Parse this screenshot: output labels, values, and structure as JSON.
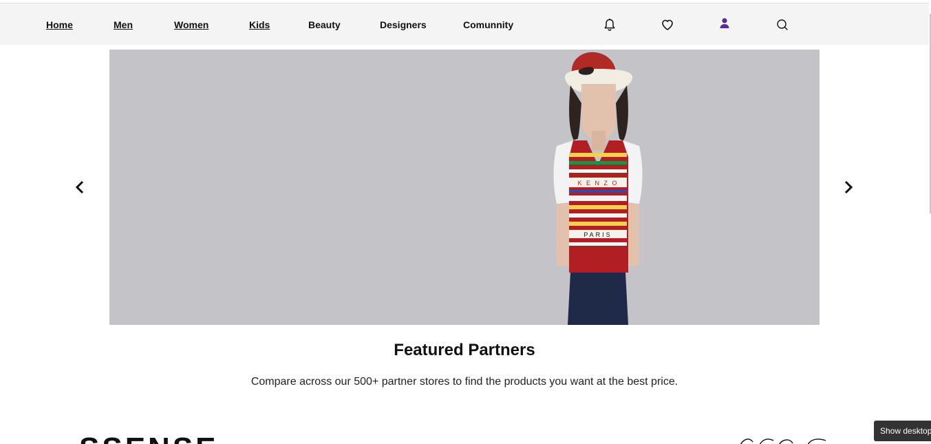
{
  "nav": {
    "links": [
      {
        "label": "Home"
      },
      {
        "label": "Men"
      },
      {
        "label": "Women"
      },
      {
        "label": "Kids"
      },
      {
        "label": "Beauty"
      },
      {
        "label": "Designers"
      },
      {
        "label": "Comunnity"
      }
    ],
    "icons": [
      "bell-icon",
      "heart-icon",
      "user-icon",
      "search-icon"
    ],
    "user_icon_color": "#5a2a9c"
  },
  "hero": {
    "background": "#c4c4c8",
    "prev_icon": "chevron-left-icon",
    "next_icon": "chevron-right-icon"
  },
  "featured": {
    "title": "Featured Partners",
    "subtitle": "Compare across our 500+ partner stores to find the products you want at the best price."
  },
  "partners": {
    "first_logo_text": "SSENSE"
  },
  "tooltip": {
    "label": "Show desktop"
  }
}
